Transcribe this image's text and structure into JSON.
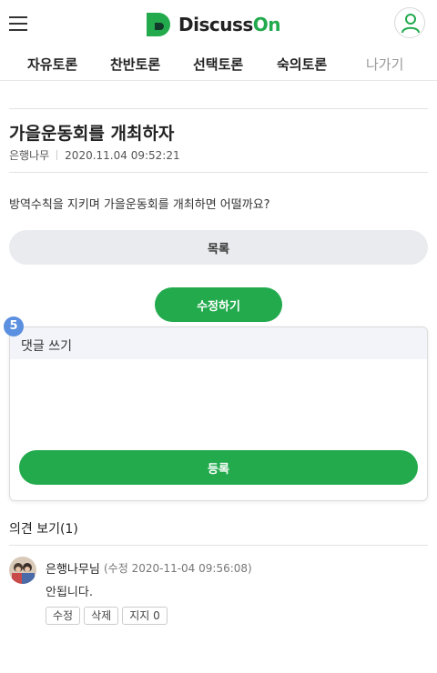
{
  "header": {
    "logo_text_main": "Discuss",
    "logo_text_accent": "On",
    "brand_color": "#22aa4d",
    "menu_icon": "hamburger-menu-icon",
    "user_icon": "user-profile-icon"
  },
  "nav": {
    "items": [
      {
        "label": "자유토론"
      },
      {
        "label": "찬반토론"
      },
      {
        "label": "선택토론"
      },
      {
        "label": "숙의토론"
      },
      {
        "label": "나가기"
      }
    ]
  },
  "post": {
    "title": "가을운동회를 개최하자",
    "author": "은행나무",
    "date": "2020.11.04 09:52:21",
    "body": "방역수칙을 지키며 가을운동회를 개최하면 어떨까요?"
  },
  "buttons": {
    "list": "목록",
    "edit": "수정하기"
  },
  "comment_form": {
    "badge": "5",
    "header": "댓글 쓰기",
    "input_value": "",
    "submit": "등록"
  },
  "opinions": {
    "title": "의견 보기(1)",
    "items": [
      {
        "author": "은행나무님",
        "edited": "(수정 2020-11-04 09:56:08)",
        "body": "안됩니다.",
        "actions": [
          "수정",
          "삭제",
          "지지 0"
        ]
      }
    ]
  }
}
